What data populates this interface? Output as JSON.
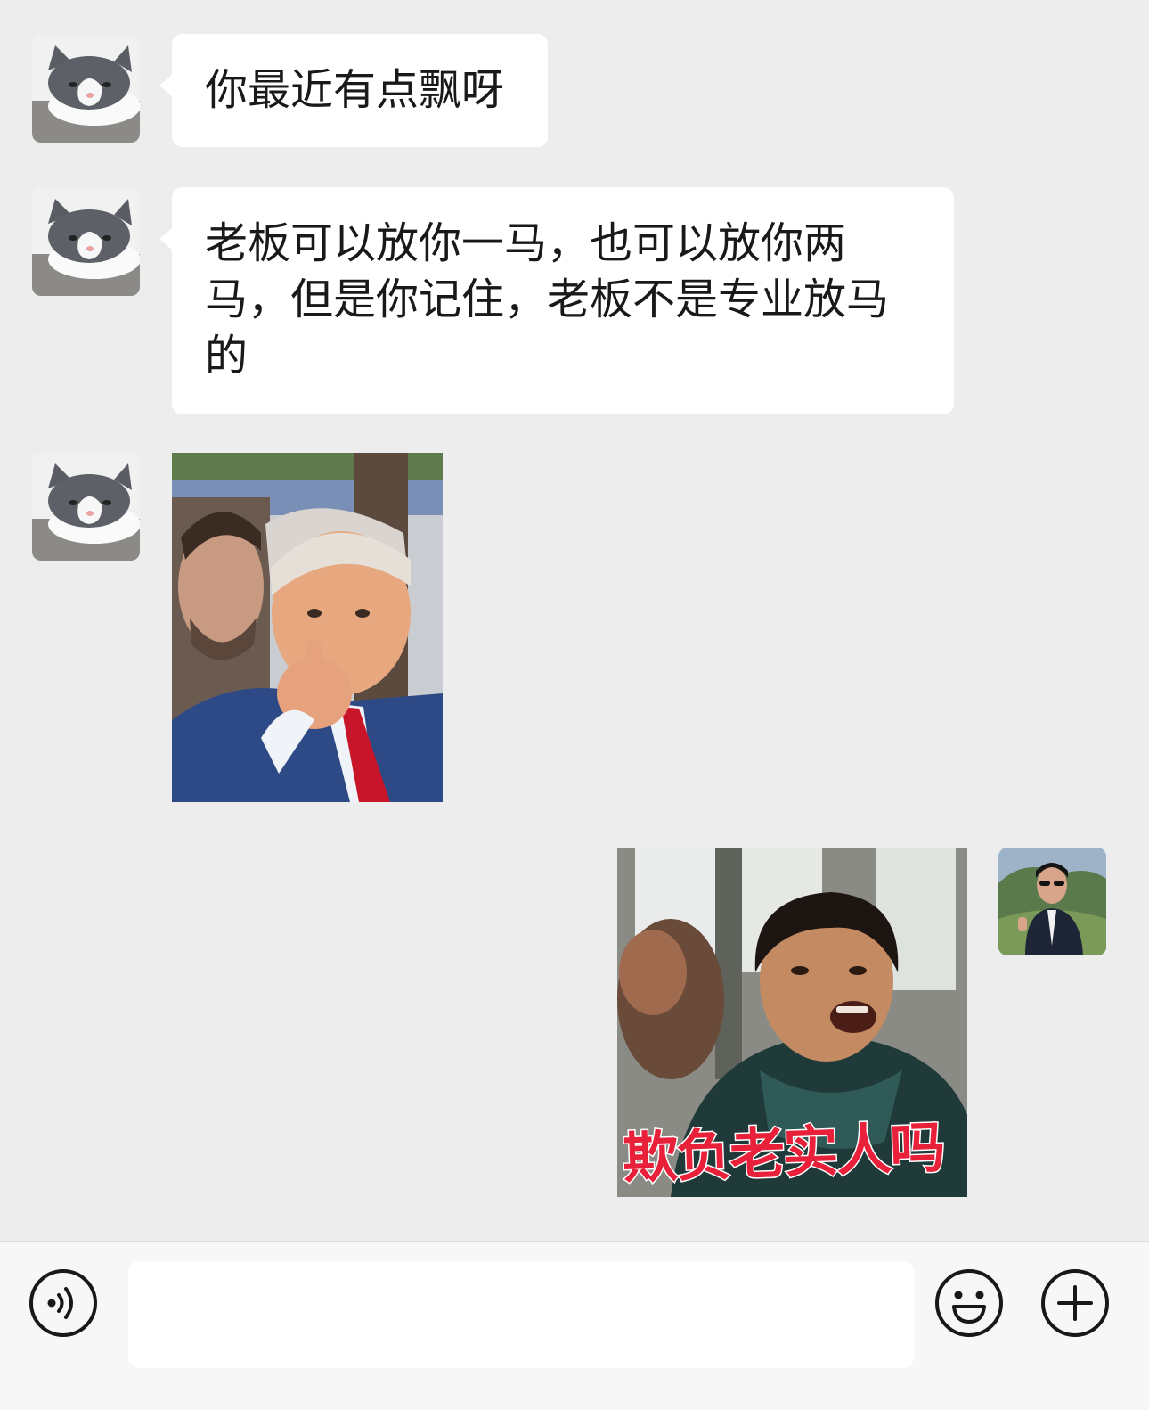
{
  "messages": [
    {
      "sender": "other",
      "type": "text",
      "text": "你最近有点飘呀"
    },
    {
      "sender": "other",
      "type": "text",
      "text": "老板可以放你一马，也可以放你两马，但是你记住，老板不是专业放马的"
    },
    {
      "sender": "other",
      "type": "image",
      "description": "man-pointing-sticker"
    },
    {
      "sender": "self",
      "type": "image",
      "caption": "欺负老实人吗"
    }
  ],
  "input_bar": {
    "message_value": "",
    "icons": [
      "voice-icon",
      "emoji-icon",
      "plus-icon"
    ]
  },
  "colors": {
    "background": "#ededed",
    "bubble_other": "#ffffff",
    "input_bar": "#f7f7f7",
    "caption_red": "#e8203a"
  }
}
